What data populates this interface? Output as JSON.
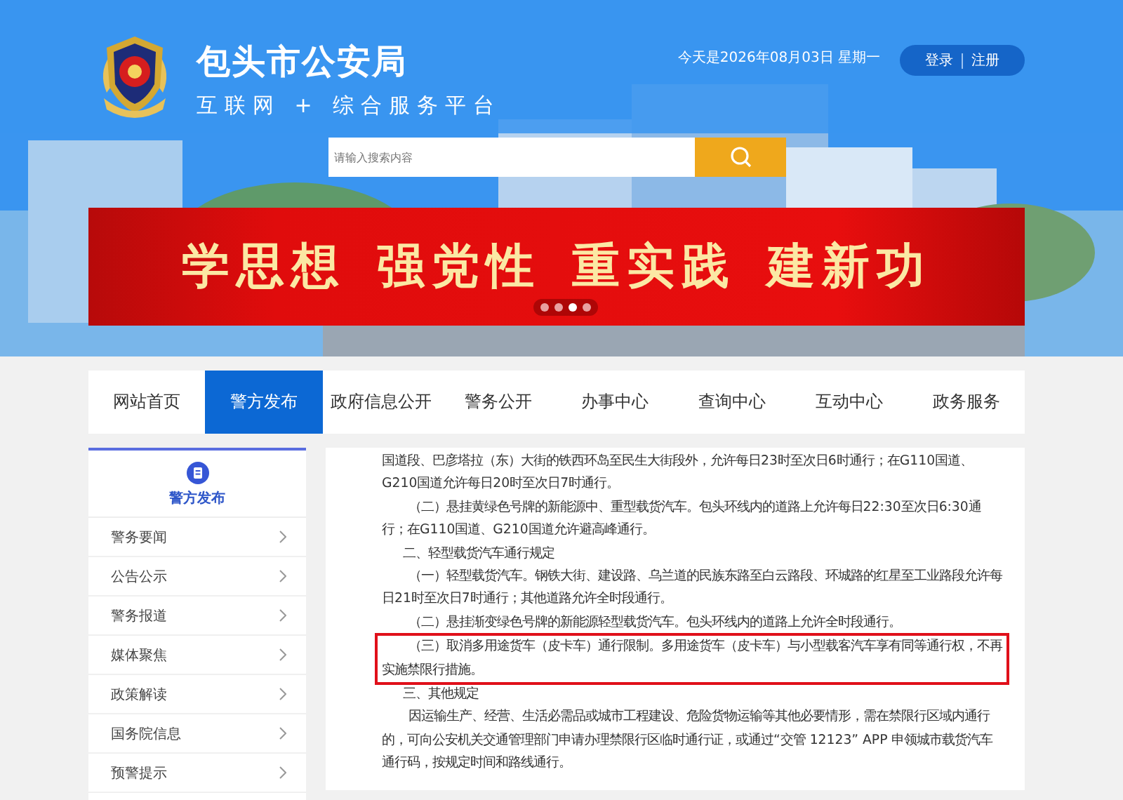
{
  "header": {
    "title": "包头市公安局",
    "subtitle": "互联网 + 综合服务平台",
    "date": "今天是2026年08月03日 星期一",
    "account": [
      "登录",
      "注册"
    ],
    "search": {
      "placeholder": "请输入搜索内容"
    }
  },
  "banner": {
    "phrases": [
      "学思想",
      "强党性",
      "重实践",
      "建新功"
    ],
    "dots": [
      {
        "selected": false
      },
      {
        "selected": false
      },
      {
        "selected": true
      },
      {
        "selected": false
      }
    ]
  },
  "nav": [
    {
      "label": "网站首页",
      "selected": false
    },
    {
      "label": "警方发布",
      "selected": true
    },
    {
      "label": "政府信息公开",
      "selected": false
    },
    {
      "label": "警务公开",
      "selected": false
    },
    {
      "label": "办事中心",
      "selected": false
    },
    {
      "label": "查询中心",
      "selected": false
    },
    {
      "label": "互动中心",
      "selected": false
    },
    {
      "label": "政务服务",
      "selected": false
    }
  ],
  "sidebar": {
    "title": "警方发布",
    "items": [
      "警务要闻",
      "公告公示",
      "警务报道",
      "媒体聚焦",
      "政策解读",
      "国务院信息",
      "预警提示"
    ]
  },
  "article": [
    {
      "kind": "continued",
      "text": "国道段、巴彦塔拉（东）大街的铁西环岛至民生大街段外，允许每日23时至次日6时通行；在G110国道、G210国道允许每日20时至次日7时通行。",
      "highlighted": false
    },
    {
      "kind": "para",
      "text": "（二）悬挂黄绿色号牌的新能源中、重型载货汽车。包头环线内的道路上允许每日22:30至次日6:30通行；在G110国道、G210国道允许避高峰通行。",
      "highlighted": false
    },
    {
      "kind": "heading",
      "text": "二、轻型载货汽车通行规定",
      "highlighted": false
    },
    {
      "kind": "para",
      "text": "（一）轻型载货汽车。钢铁大街、建设路、乌兰道的民族东路至白云路段、环城路的红星至工业路段允许每日21时至次日7时通行；其他道路允许全时段通行。",
      "highlighted": false
    },
    {
      "kind": "para",
      "text": "（二）悬挂渐变绿色号牌的新能源轻型载货汽车。包头环线内的道路上允许全时段通行。",
      "highlighted": false
    },
    {
      "kind": "para",
      "text": "（三）取消多用途货车（皮卡车）通行限制。多用途货车（皮卡车）与小型载客汽车享有同等通行权，不再实施禁限行措施。",
      "highlighted": true
    },
    {
      "kind": "heading",
      "text": "三、其他规定",
      "highlighted": false
    },
    {
      "kind": "para",
      "text": "因运输生产、经营、生活必需品或城市工程建设、危险货物运输等其他必要情形，需在禁限行区域内通行的，可向公安机关交通管理部门申请办理禁限行区临时通行证，或通过“交管 12123” APP 申领城市载货汽车通行码，按规定时间和路线通行。",
      "highlighted": false
    }
  ]
}
